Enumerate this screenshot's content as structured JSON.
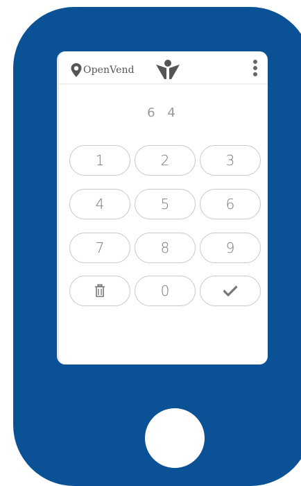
{
  "app": {
    "brand_name": "OpenVend",
    "entered_code": "6 4",
    "accent_color": "#0a5196"
  },
  "keypad": {
    "keys": [
      {
        "label": "1"
      },
      {
        "label": "2"
      },
      {
        "label": "3"
      },
      {
        "label": "4"
      },
      {
        "label": "5"
      },
      {
        "label": "6"
      },
      {
        "label": "7"
      },
      {
        "label": "8"
      },
      {
        "label": "9"
      },
      {
        "icon": "trash-icon"
      },
      {
        "label": "0"
      },
      {
        "icon": "checkmark-icon"
      }
    ]
  }
}
